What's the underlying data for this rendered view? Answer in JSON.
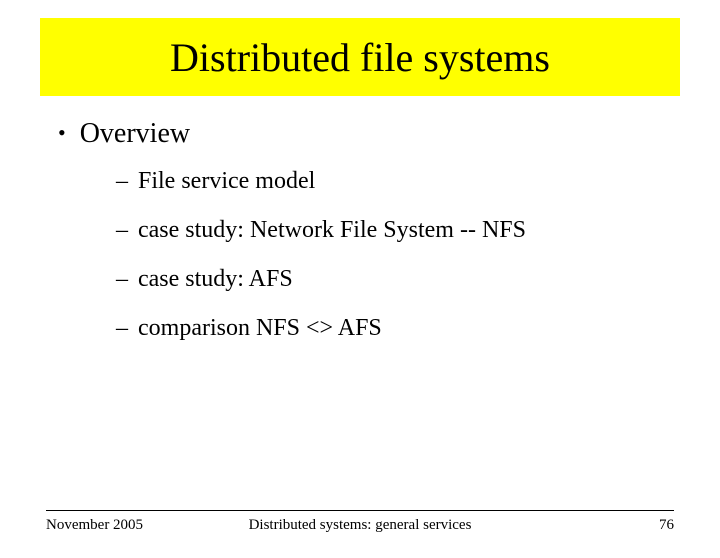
{
  "slide": {
    "title": "Distributed file systems",
    "bullet": {
      "label": "Overview",
      "subitems": [
        "File service model",
        "case study: Network File System -- NFS",
        "case study: AFS",
        "comparison NFS <> AFS"
      ]
    }
  },
  "footer": {
    "date": "November 2005",
    "subject": "Distributed systems: general services",
    "page": "76"
  }
}
